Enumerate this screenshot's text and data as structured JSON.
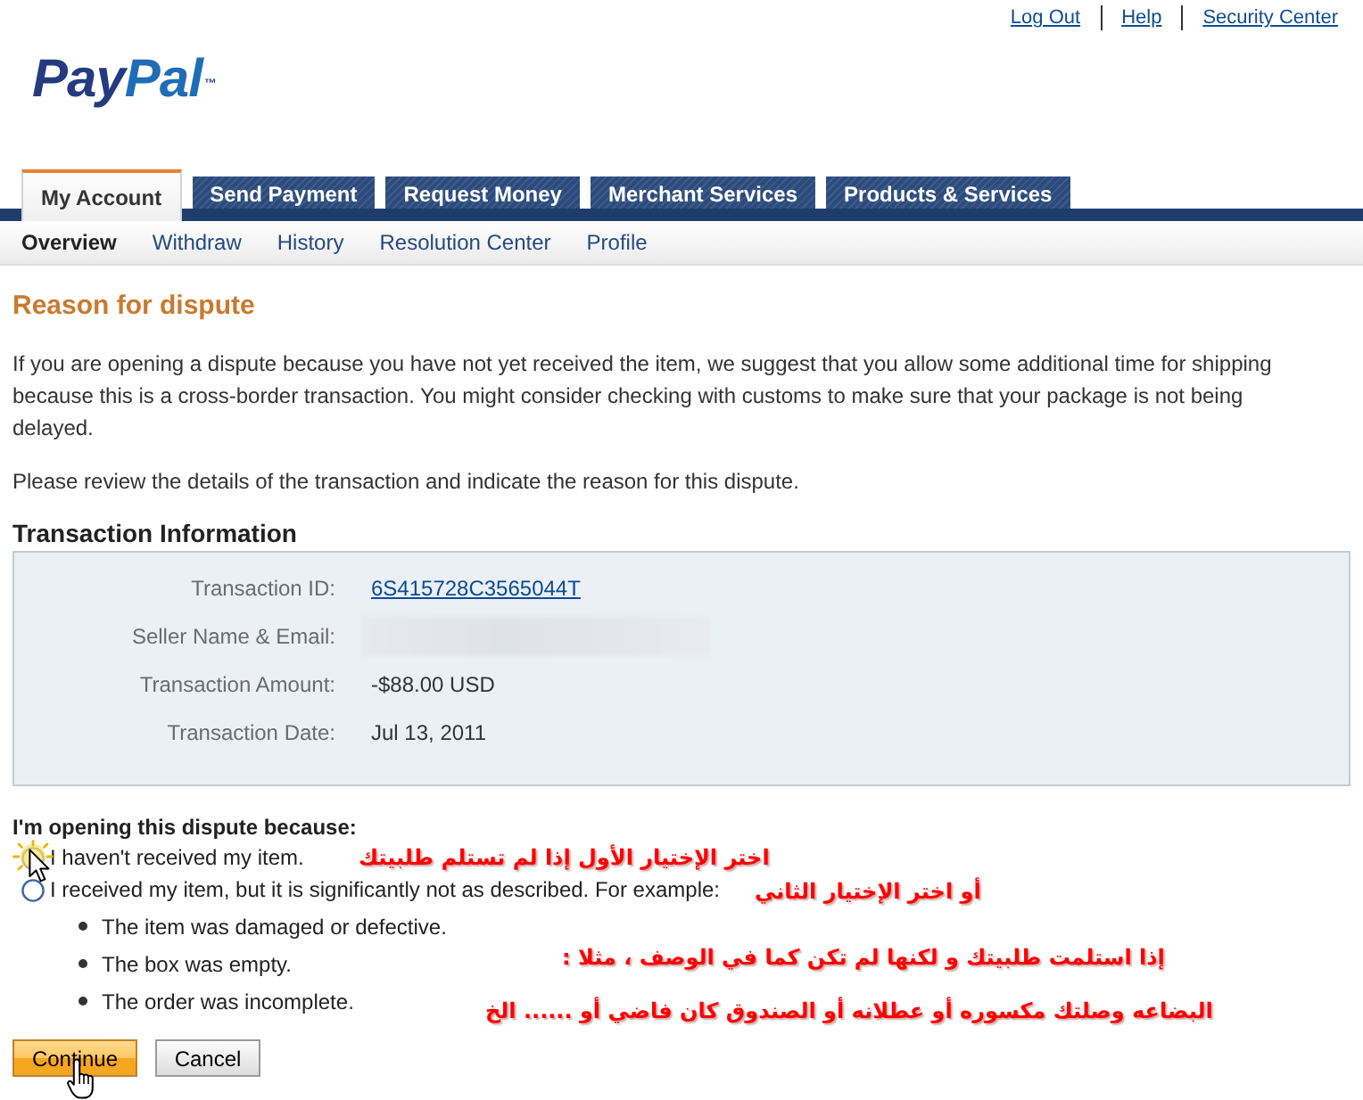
{
  "header_links": [
    {
      "label": "Log Out"
    },
    {
      "label": "Help"
    },
    {
      "label": "Security Center"
    }
  ],
  "logo": {
    "parts": [
      "Pay",
      "Pal"
    ],
    "mark": "™"
  },
  "tabs": [
    {
      "label": "My Account",
      "selected": true
    },
    {
      "label": "Send Payment",
      "selected": false
    },
    {
      "label": "Request Money",
      "selected": false
    },
    {
      "label": "Merchant Services",
      "selected": false
    },
    {
      "label": "Products & Services",
      "selected": false
    }
  ],
  "subnav": [
    {
      "label": "Overview",
      "selected": true
    },
    {
      "label": "Withdraw",
      "selected": false
    },
    {
      "label": "History",
      "selected": false
    },
    {
      "label": "Resolution Center",
      "selected": false
    },
    {
      "label": "Profile",
      "selected": false
    }
  ],
  "page_title": "Reason for dispute",
  "intro_paragraphs": [
    "If you are opening a dispute because you have not yet received the item, we suggest that you allow some additional time for shipping because this is a cross-border transaction. You might consider checking with customs to make sure that your package is not being delayed.",
    "Please review the details of the transaction and indicate the reason for this dispute."
  ],
  "transaction_info": {
    "title": "Transaction Information",
    "rows": [
      {
        "label": "Transaction ID:",
        "kind": "link",
        "value": "6S415728C3565044T"
      },
      {
        "label": "Seller Name & Email:",
        "kind": "redacted"
      },
      {
        "label": "Transaction Amount:",
        "kind": "text",
        "value": "-$88.00 USD"
      },
      {
        "label": "Transaction Date:",
        "kind": "text",
        "value": "Jul 13, 2011"
      }
    ]
  },
  "dispute": {
    "prompt": "I'm opening this dispute because:",
    "options": [
      {
        "label": "I haven't received my item.",
        "selected": false,
        "highlighted": true
      },
      {
        "label": "I received my item, but it is significantly not as described. For example:",
        "selected": false,
        "highlighted": false
      }
    ],
    "examples": [
      "The item was damaged or defective.",
      "The box was empty.",
      "The order was incomplete."
    ]
  },
  "buttons": [
    {
      "label": "Continue",
      "kind": "primary"
    },
    {
      "label": "Cancel",
      "kind": "secondary"
    }
  ],
  "annotations": [
    "اختر الإختيار الأول إذا لم تستلم طلبيتك",
    "أو اختر الإختيار الثاني",
    "إذا استلمت طلبيتك و لكنها لم تكن كما في الوصف ، مثلا :",
    "البضاعه وصلتك مكسوره أو عطلانه أو الصندوق كان فاضي أو ...... الخ"
  ]
}
